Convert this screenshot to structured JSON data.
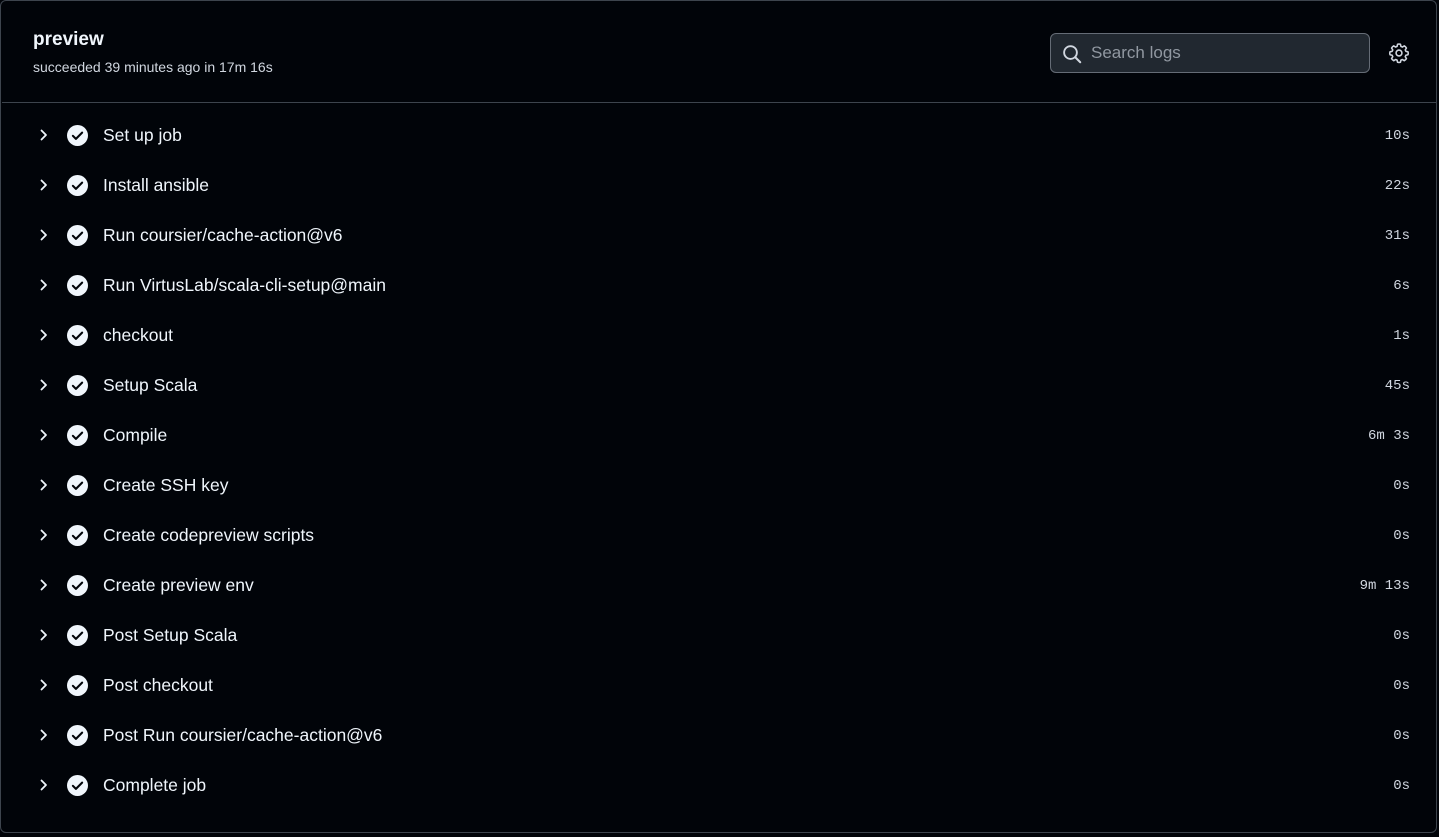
{
  "job": {
    "title": "preview",
    "status_text": "succeeded 39 minutes ago in 17m 16s"
  },
  "search": {
    "placeholder": "Search logs",
    "value": ""
  },
  "icons": {
    "search": "search-icon",
    "settings": "gear-icon",
    "expand": "chevron-right-icon",
    "status": "check-circle-icon"
  },
  "colors": {
    "background": "#010409",
    "border": "#3d444d",
    "text": "#f0f6fc",
    "muted_text": "#d1d7e0",
    "search_bg": "#212830"
  },
  "steps": [
    {
      "name": "Set up job",
      "duration": "10s",
      "status": "success"
    },
    {
      "name": "Install ansible",
      "duration": "22s",
      "status": "success"
    },
    {
      "name": "Run coursier/cache-action@v6",
      "duration": "31s",
      "status": "success"
    },
    {
      "name": "Run VirtusLab/scala-cli-setup@main",
      "duration": "6s",
      "status": "success"
    },
    {
      "name": "checkout",
      "duration": "1s",
      "status": "success"
    },
    {
      "name": "Setup Scala",
      "duration": "45s",
      "status": "success"
    },
    {
      "name": "Compile",
      "duration": "6m 3s",
      "status": "success"
    },
    {
      "name": "Create SSH key",
      "duration": "0s",
      "status": "success"
    },
    {
      "name": "Create codepreview scripts",
      "duration": "0s",
      "status": "success"
    },
    {
      "name": "Create preview env",
      "duration": "9m 13s",
      "status": "success"
    },
    {
      "name": "Post Setup Scala",
      "duration": "0s",
      "status": "success"
    },
    {
      "name": "Post checkout",
      "duration": "0s",
      "status": "success"
    },
    {
      "name": "Post Run coursier/cache-action@v6",
      "duration": "0s",
      "status": "success"
    },
    {
      "name": "Complete job",
      "duration": "0s",
      "status": "success"
    }
  ]
}
